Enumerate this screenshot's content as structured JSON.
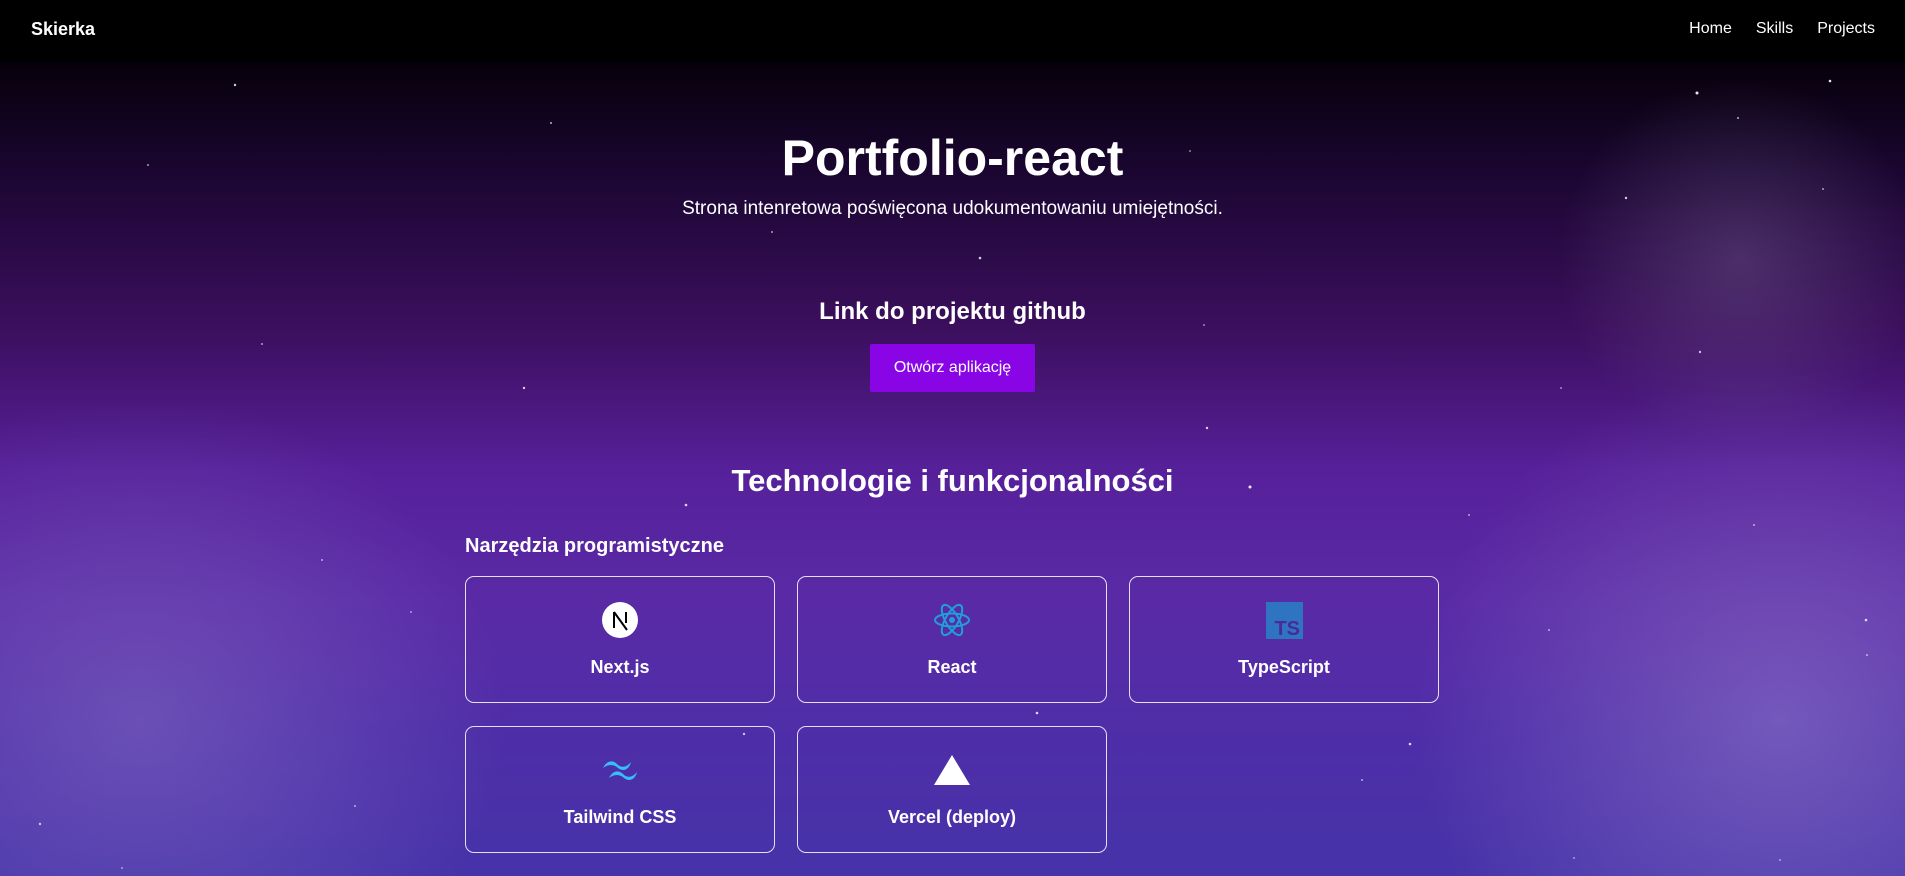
{
  "navbar": {
    "brand": "Skierka",
    "links": [
      "Home",
      "Skills",
      "Projects"
    ]
  },
  "hero": {
    "title": "Portfolio-react",
    "subtitle": "Strona intenretowa poświęcona udokumentowaniu umiejętności."
  },
  "github_section": {
    "heading": "Link do projektu github",
    "button_label": "Otwórz aplikację"
  },
  "technologies": {
    "heading": "Technologie i funkcjonalności",
    "tools_heading": "Narzędzia programistyczne",
    "cards": [
      {
        "label": "Next.js",
        "icon": "nextjs-icon"
      },
      {
        "label": "React",
        "icon": "react-icon"
      },
      {
        "label": "TypeScript",
        "icon": "typescript-icon"
      },
      {
        "label": "Tailwind CSS",
        "icon": "tailwind-icon"
      },
      {
        "label": "Vercel (deploy)",
        "icon": "vercel-icon"
      }
    ]
  },
  "colors": {
    "button": "#8a05e6",
    "react": "#1f9ed8",
    "typescript": "#2f74c0",
    "tailwind": "#38bdf8"
  }
}
